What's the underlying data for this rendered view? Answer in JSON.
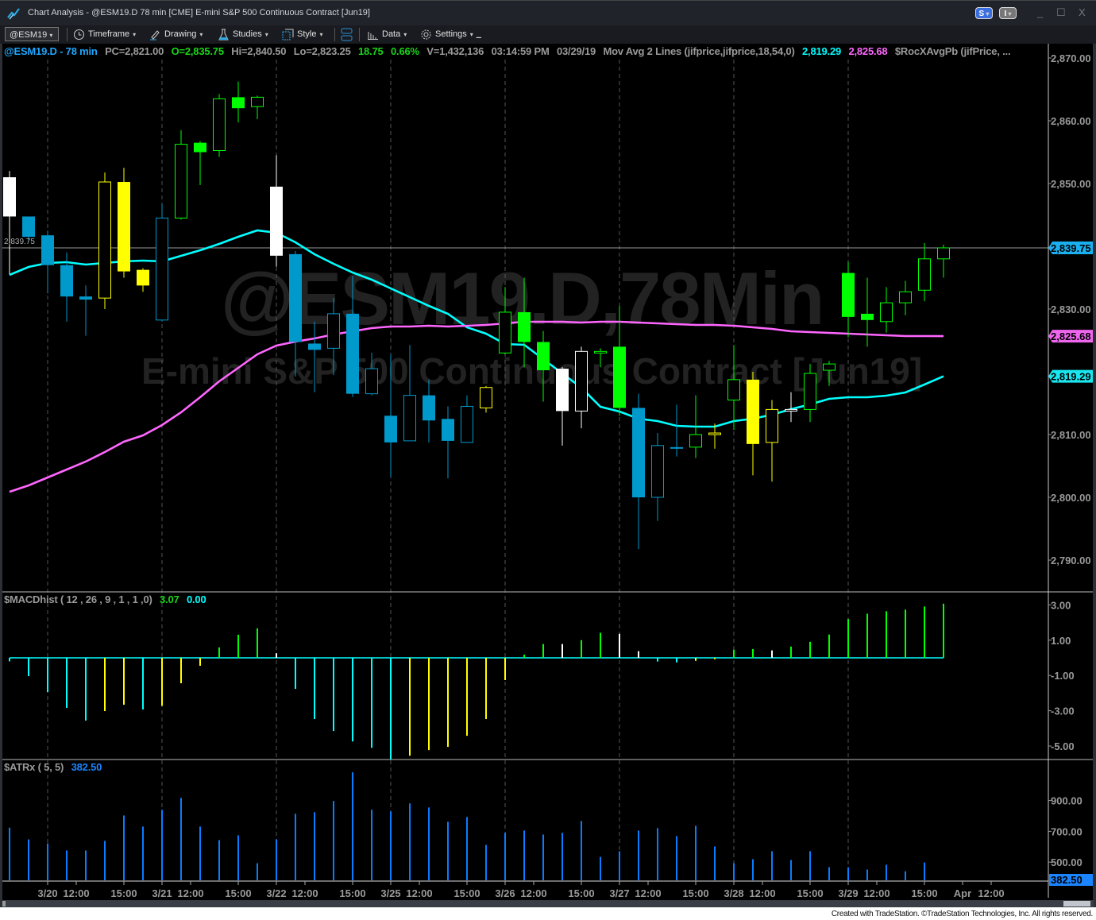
{
  "window": {
    "title": "Chart Analysis - @ESM19.D 78 min [CME] E-mini S&P 500 Continuous Contract [Jun19]",
    "badge_s": "S",
    "badge_i": "I",
    "minimize": "_",
    "maximize": "☐",
    "close": "X"
  },
  "toolbar": {
    "symbol": "@ESM19",
    "timeframe": "Timeframe",
    "drawing": "Drawing",
    "studies": "Studies",
    "style": "Style",
    "data": "Data",
    "settings": "Settings"
  },
  "header": {
    "symbol": "@ESM19.D - 78 min",
    "pc": "PC=2,821.00",
    "open": "O=2,835.75",
    "high": "Hi=2,840.50",
    "low": "Lo=2,823.25",
    "change": "18.75",
    "change_pct": "0.66%",
    "volume": "V=1,432,136",
    "time": "03:14:59 PM",
    "date": "03/29/19",
    "study": "Mov Avg 2 Lines (jifprice,jifprice,18,54,0)",
    "ma_fast": "2,819.29",
    "ma_slow": "2,825.68",
    "study2": "$RocXAvgPb (jifPrice, ..."
  },
  "watermark": {
    "line1": "@ESM19.D,78Min",
    "line2": "E-mini S&P 500 Continuous Contract [Jun19]"
  },
  "last_price_label": "2,839.75",
  "macd_header": {
    "name": "$MACDhist ( 12 , 26 , 9 , 1 , 1 ,0)",
    "value": "3.07",
    "zero": "0.00"
  },
  "atr_header": {
    "name": "$ATRx ( 5, 5)",
    "value": "382.50"
  },
  "footer": "Created with TradeStation. ©TradeStation Technologies, Inc. All rights reserved.",
  "colors": {
    "white": "#ffffff",
    "blue": "#0099cc",
    "yellow": "#ffff00",
    "green": "#00ff00",
    "cyan": "#00ffff",
    "magenta": "#ff66ff",
    "atr": "#0a7cff"
  },
  "chart_data": [
    {
      "type": "candlestick",
      "title": "@ESM19.D 78 min",
      "ylim": [
        2785,
        2871.5
      ],
      "yticks": [
        "2,870.00",
        "2,860.00",
        "2,850.00",
        "2,830.00",
        "2,810.00",
        "2,800.00",
        "2,790.00"
      ],
      "ytick_values": [
        2870,
        2860,
        2850,
        2830,
        2810,
        2800,
        2790
      ],
      "price_markers": [
        {
          "value": 2839.75,
          "label": "2,839.75",
          "color": "#1ab0ef"
        },
        {
          "value": 2825.68,
          "label": "2,825.68",
          "color": "#ee66ee"
        },
        {
          "value": 2819.29,
          "label": "2,819.29",
          "color": "#19e6ee"
        }
      ],
      "candles_fields": [
        "open",
        "high",
        "low",
        "close",
        "color",
        "filled"
      ],
      "candles": [
        [
          2851.0,
          2852.0,
          2835.5,
          2844.75,
          "white",
          1
        ],
        [
          2844.75,
          2844.75,
          2840.75,
          2841.5,
          "blue",
          1
        ],
        [
          2841.75,
          2842.5,
          2832.5,
          2837.0,
          "blue",
          1
        ],
        [
          2837.0,
          2839.0,
          2828.0,
          2832.0,
          "blue",
          1
        ],
        [
          2832.0,
          2833.75,
          2825.75,
          2831.5,
          "blue",
          1
        ],
        [
          2831.75,
          2851.75,
          2830.0,
          2850.25,
          "yellow",
          0
        ],
        [
          2850.25,
          2852.5,
          2835.0,
          2836.0,
          "yellow",
          1
        ],
        [
          2836.25,
          2836.5,
          2832.75,
          2833.75,
          "yellow",
          1
        ],
        [
          2828.25,
          2846.75,
          2828.0,
          2844.5,
          "blue",
          0
        ],
        [
          2844.5,
          2858.5,
          2844.25,
          2856.25,
          "green",
          0
        ],
        [
          2856.5,
          2856.75,
          2849.75,
          2855.0,
          "green",
          1
        ],
        [
          2855.25,
          2864.25,
          2854.25,
          2863.5,
          "green",
          0
        ],
        [
          2863.75,
          2866.25,
          2859.75,
          2862.0,
          "green",
          1
        ],
        [
          2862.25,
          2864.0,
          2860.25,
          2863.75,
          "green",
          0
        ],
        [
          2849.5,
          2854.5,
          2836.75,
          2838.5,
          "white",
          1
        ],
        [
          2838.75,
          2839.25,
          2819.25,
          2824.75,
          "blue",
          1
        ],
        [
          2824.5,
          2828.0,
          2816.75,
          2823.5,
          "blue",
          1
        ],
        [
          2823.75,
          2831.75,
          2819.5,
          2829.25,
          "blue",
          0
        ],
        [
          2829.25,
          2835.25,
          2816.0,
          2816.5,
          "blue",
          1
        ],
        [
          2816.5,
          2823.0,
          2816.25,
          2820.5,
          "blue",
          0
        ],
        [
          2813.0,
          2822.75,
          2803.25,
          2808.75,
          "blue",
          1
        ],
        [
          2809.0,
          2824.25,
          2809.0,
          2816.25,
          "blue",
          0
        ],
        [
          2816.25,
          2818.75,
          2808.75,
          2812.25,
          "blue",
          1
        ],
        [
          2812.5,
          2814.5,
          2803.0,
          2809.0,
          "blue",
          1
        ],
        [
          2808.75,
          2816.25,
          2808.75,
          2814.5,
          "blue",
          0
        ],
        [
          2814.25,
          2817.75,
          2813.5,
          2817.5,
          "yellow",
          0
        ],
        [
          2823.0,
          2833.5,
          2822.75,
          2829.5,
          "green",
          0
        ],
        [
          2829.5,
          2835.0,
          2820.75,
          2824.75,
          "green",
          1
        ],
        [
          2824.75,
          2826.5,
          2815.25,
          2820.25,
          "green",
          1
        ],
        [
          2820.5,
          2820.75,
          2808.25,
          2813.75,
          "white",
          1
        ],
        [
          2813.75,
          2824.0,
          2811.0,
          2823.25,
          "white",
          0
        ],
        [
          2823.25,
          2823.75,
          2820.75,
          2823.25,
          "green",
          0
        ],
        [
          2824.0,
          2830.5,
          2813.0,
          2814.25,
          "green",
          1
        ],
        [
          2814.25,
          2816.5,
          2791.75,
          2800.0,
          "blue",
          1
        ],
        [
          2800.0,
          2810.25,
          2796.25,
          2808.25,
          "blue",
          0
        ],
        [
          2808.0,
          2814.75,
          2806.5,
          2807.75,
          "blue",
          1
        ],
        [
          2808.0,
          2816.25,
          2806.25,
          2810.0,
          "green",
          0
        ],
        [
          2810.0,
          2811.75,
          2807.75,
          2810.25,
          "yellow",
          0
        ],
        [
          2815.5,
          2824.25,
          2810.75,
          2818.75,
          "green",
          0
        ],
        [
          2818.75,
          2820.0,
          2803.5,
          2808.5,
          "yellow",
          1
        ],
        [
          2808.75,
          2815.5,
          2802.5,
          2814.0,
          "yellow",
          0
        ],
        [
          2814.0,
          2816.75,
          2812.0,
          2814.0,
          "white",
          0
        ],
        [
          2814.0,
          2821.25,
          2812.0,
          2819.75,
          "green",
          0
        ],
        [
          2820.25,
          2821.75,
          2817.75,
          2821.25,
          "green",
          0
        ],
        [
          2835.75,
          2837.5,
          2825.5,
          2828.75,
          "green",
          1
        ],
        [
          2829.25,
          2835.0,
          2824.0,
          2828.25,
          "green",
          1
        ],
        [
          2828.0,
          2833.5,
          2826.25,
          2831.0,
          "green",
          0
        ],
        [
          2831.0,
          2834.5,
          2829.0,
          2832.75,
          "green",
          0
        ],
        [
          2833.0,
          2840.5,
          2831.25,
          2838.0,
          "green",
          0
        ],
        [
          2838.0,
          2840.25,
          2835.0,
          2839.75,
          "green",
          0
        ]
      ],
      "series": [
        {
          "name": "Mov Avg fast (18)",
          "color": "#00ffff",
          "values": [
            2835.44,
            2836.71,
            2837.34,
            2837.47,
            2837.09,
            2837.34,
            2837.59,
            2837.72,
            2837.59,
            2838.48,
            2839.37,
            2840.38,
            2841.52,
            2842.53,
            2842.15,
            2840.63,
            2838.73,
            2837.22,
            2835.82,
            2834.68,
            2833.29,
            2831.9,
            2830.51,
            2829.24,
            2827.09,
            2826.08,
            2824.43,
            2824.3,
            2822.03,
            2819.75,
            2817.47,
            2814.43,
            2813.67,
            2812.53,
            2812.15,
            2811.39,
            2811.27,
            2811.27,
            2812.15,
            2812.53,
            2813.16,
            2814.05,
            2814.81,
            2815.7,
            2815.95,
            2815.95,
            2816.2,
            2816.71,
            2817.97,
            2819.29
          ]
        },
        {
          "name": "Mov Avg slow (54)",
          "color": "#ff66ff",
          "values": [
            2800.89,
            2801.9,
            2803.16,
            2804.43,
            2805.7,
            2807.22,
            2808.86,
            2809.87,
            2811.52,
            2813.54,
            2815.95,
            2818.48,
            2820.63,
            2822.78,
            2824.18,
            2824.81,
            2825.32,
            2825.95,
            2826.46,
            2826.96,
            2827.22,
            2827.22,
            2827.34,
            2827.22,
            2827.34,
            2827.47,
            2827.72,
            2827.97,
            2827.97,
            2827.97,
            2827.85,
            2827.97,
            2827.97,
            2827.85,
            2827.72,
            2827.59,
            2827.47,
            2827.47,
            2827.34,
            2827.09,
            2826.84,
            2826.46,
            2826.33,
            2826.2,
            2826.08,
            2825.95,
            2825.82,
            2825.7,
            2825.7,
            2825.68
          ]
        }
      ]
    },
    {
      "type": "bar",
      "title": "$MACDhist ( 12 , 26 , 9 , 1 , 1 ,0)",
      "ylim": [
        -5.72,
        3.69
      ],
      "yticks": [
        "3.00",
        "1.00",
        "-1.00",
        "-3.00",
        "-5.00"
      ],
      "ytick_values": [
        3,
        1,
        -1,
        -3,
        -5
      ],
      "values": [
        -0.2,
        -1.04,
        -1.94,
        -2.84,
        -3.56,
        -3.02,
        -2.66,
        -2.93,
        -2.72,
        -1.44,
        -0.45,
        0.59,
        1.31,
        1.67,
        0.26,
        -1.76,
        -3.47,
        -4.15,
        -4.74,
        -5.1,
        -5.76,
        -5.55,
        -5.23,
        -5.05,
        -4.42,
        -3.47,
        -1.26,
        0.18,
        0.78,
        0.78,
        1.0,
        1.42,
        1.36,
        0.38,
        -0.21,
        -0.26,
        -0.17,
        -0.08,
        0.46,
        0.5,
        0.42,
        0.64,
        0.91,
        1.32,
        2.2,
        2.5,
        2.64,
        2.73,
        2.91,
        3.07
      ],
      "bar_colors": [
        "cyan",
        "cyan",
        "cyan",
        "cyan",
        "cyan",
        "yellow",
        "yellow",
        "cyan",
        "yellow",
        "yellow",
        "yellow",
        "green",
        "green",
        "green",
        "white",
        "cyan",
        "cyan",
        "cyan",
        "cyan",
        "cyan",
        "cyan",
        "yellow",
        "yellow",
        "yellow",
        "yellow",
        "yellow",
        "yellow",
        "green",
        "green",
        "white",
        "green",
        "green",
        "white",
        "white",
        "cyan",
        "cyan",
        "yellow",
        "yellow",
        "green",
        "green",
        "white",
        "green",
        "green",
        "green",
        "green",
        "green",
        "green",
        "green",
        "green",
        "green"
      ]
    },
    {
      "type": "bar",
      "title": "$ATRx ( 5, 5)",
      "ylim": [
        382.5,
        1160
      ],
      "yticks": [
        "900.00",
        "700.00",
        "500.00"
      ],
      "ytick_values": [
        900,
        700,
        500
      ],
      "last_label": "382.50",
      "values": [
        724,
        648,
        621,
        576,
        576,
        638,
        803,
        731,
        840,
        917,
        731,
        643,
        674,
        493,
        648,
        814,
        824,
        897,
        1083,
        840,
        829,
        881,
        855,
        762,
        793,
        612,
        690,
        705,
        679,
        690,
        767,
        534,
        571,
        705,
        721,
        669,
        736,
        602,
        493,
        519,
        571,
        514,
        571,
        467,
        467,
        452,
        483,
        441,
        498,
        382.5
      ]
    }
  ],
  "time_axis": {
    "labels": [
      {
        "bar": 2,
        "text": "3/20"
      },
      {
        "bar": 3.5,
        "text": "12:00"
      },
      {
        "bar": 6,
        "text": "15:00"
      },
      {
        "bar": 8,
        "text": "3/21"
      },
      {
        "bar": 9.5,
        "text": "12:00"
      },
      {
        "bar": 12,
        "text": "15:00"
      },
      {
        "bar": 14,
        "text": "3/22"
      },
      {
        "bar": 15.5,
        "text": "12:00"
      },
      {
        "bar": 18,
        "text": "15:00"
      },
      {
        "bar": 20,
        "text": "3/25"
      },
      {
        "bar": 21.5,
        "text": "12:00"
      },
      {
        "bar": 24,
        "text": "15:00"
      },
      {
        "bar": 26,
        "text": "3/26"
      },
      {
        "bar": 27.5,
        "text": "12:00"
      },
      {
        "bar": 30,
        "text": "15:00"
      },
      {
        "bar": 32,
        "text": "3/27"
      },
      {
        "bar": 33.5,
        "text": "12:00"
      },
      {
        "bar": 36,
        "text": "15:00"
      },
      {
        "bar": 38,
        "text": "3/28"
      },
      {
        "bar": 39.5,
        "text": "12:00"
      },
      {
        "bar": 42,
        "text": "15:00"
      },
      {
        "bar": 44,
        "text": "3/29"
      },
      {
        "bar": 45.5,
        "text": "12:00"
      },
      {
        "bar": 48,
        "text": "15:00"
      },
      {
        "bar": 50,
        "text": "Apr"
      },
      {
        "bar": 51.5,
        "text": "12:00"
      }
    ],
    "day_breaks": [
      2,
      8,
      14,
      20,
      26,
      32,
      38,
      44
    ]
  }
}
